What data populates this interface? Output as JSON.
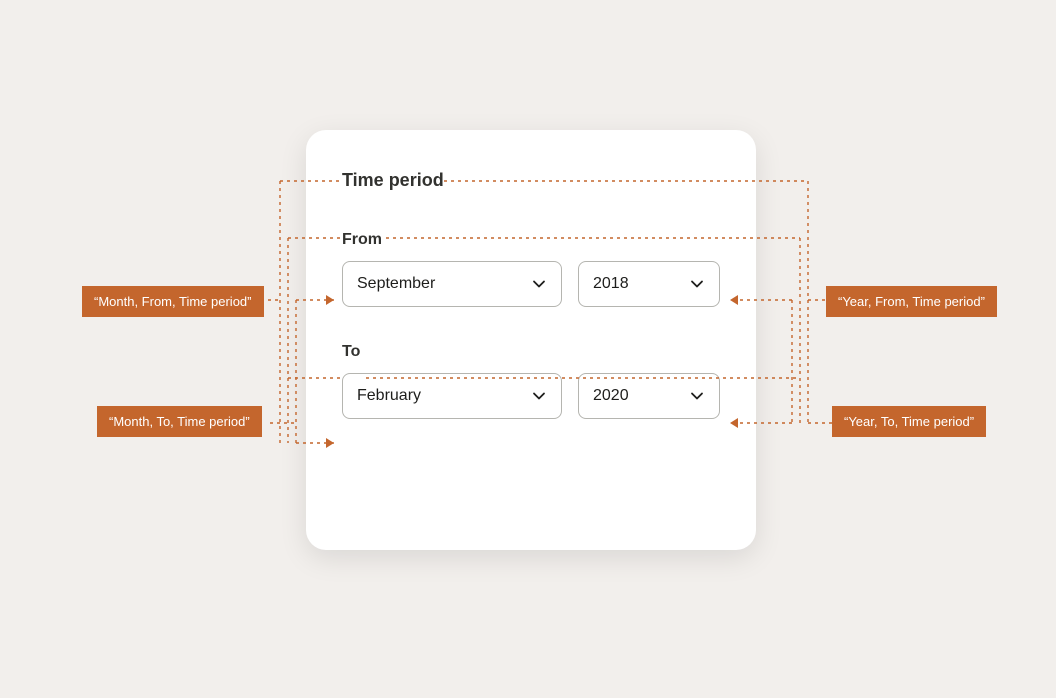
{
  "card": {
    "heading": "Time period",
    "from": {
      "label": "From",
      "month": "September",
      "year": "2018"
    },
    "to": {
      "label": "To",
      "month": "February",
      "year": "2020"
    }
  },
  "annotations": {
    "from_month": "“Month, From, Time period”",
    "from_year": "“Year, From, Time period”",
    "to_month": "“Month, To, Time period”",
    "to_year": "“Year, To, Time period”"
  },
  "colors": {
    "accent": "#c4662d",
    "background": "#f2efec",
    "card": "#ffffff",
    "text": "#32322f",
    "border": "#b5b5b0"
  }
}
